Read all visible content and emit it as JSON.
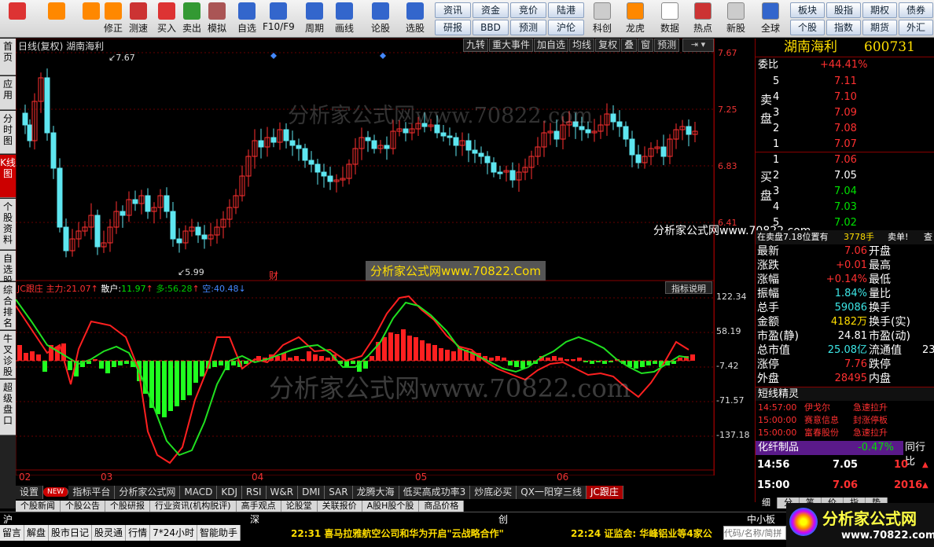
{
  "toolbar": {
    "left_buttons": [
      {
        "label": "",
        "icon": "grid-icon"
      },
      {
        "label": "",
        "icon": "back-arrow-icon"
      },
      {
        "label": "",
        "icon": "up-arrow-icon"
      },
      {
        "label": "修正",
        "icon": "refresh-icon"
      },
      {
        "label": "测速",
        "icon": "clock-icon"
      },
      {
        "label": "买入",
        "icon": "buy-icon"
      },
      {
        "label": "卖出",
        "icon": "sell-icon"
      },
      {
        "label": "模拟",
        "icon": "hammer-icon"
      },
      {
        "label": "自选",
        "icon": "star-icon"
      },
      {
        "label": "F10/F9",
        "icon": "f10-icon"
      },
      {
        "label": "周期",
        "icon": "cycle-icon"
      },
      {
        "label": "画线",
        "icon": "pencil-icon"
      },
      {
        "label": "论股",
        "icon": "discuss-icon"
      },
      {
        "label": "选股",
        "icon": "select-icon"
      }
    ],
    "grid1": [
      "资讯",
      "资金",
      "竞价",
      "陆港",
      "研报",
      "BBD",
      "预测",
      "沪伦"
    ],
    "mid_buttons": [
      {
        "label": "科创",
        "icon": "star-market-icon"
      },
      {
        "label": "龙虎",
        "icon": "dragon-icon"
      },
      {
        "label": "数据",
        "icon": "pe-icon"
      },
      {
        "label": "热点",
        "icon": "hot-icon"
      },
      {
        "label": "新股",
        "icon": "ipo-icon"
      },
      {
        "label": "全球",
        "icon": "globe-icon"
      }
    ],
    "grid2": [
      "板块",
      "股指",
      "期权",
      "债券",
      "个股",
      "指数",
      "期货",
      "外汇"
    ]
  },
  "left_tabs": [
    "首页",
    "应用",
    "分时图",
    "K线图",
    "个股资料",
    "自选股",
    "综合排名",
    "牛叉诊股",
    "超级盘口"
  ],
  "chart": {
    "header_left": "日线(复权) 湖南海利",
    "top_buttons": [
      "九转",
      "重大事件",
      "加自选",
      "均线",
      "复权",
      "叠",
      "窗",
      "预测"
    ],
    "price_high_label": "7.67",
    "price_low_label": "5.99",
    "event_marker": "财",
    "axis_prices": [
      "7.67",
      "7.25",
      "6.83",
      "6.41"
    ],
    "indicator_header": {
      "name": "JC跟庄",
      "main_label": "主力:",
      "main_value": "21.07",
      "retail_label": "散户:",
      "retail_value": "11.97",
      "long_label": "多:",
      "long_value": "56.28",
      "short_label": "空:",
      "short_value": "40.48"
    },
    "indicator_button": "指标说明",
    "indicator_axis": [
      "122.34",
      "58.19",
      "-7.42",
      "-71.57",
      "-137.18"
    ],
    "watermarks": [
      "分析家公式网www.70822.com",
      "分析家公式网www.70822.Com",
      "分析家公式网www.70822.com"
    ],
    "month_labels": [
      "02",
      "03",
      "04",
      "05",
      "06"
    ]
  },
  "indicator_tabs": [
    "设置",
    "NEW",
    "指标平台",
    "分析家公式网",
    "MACD",
    "KDJ",
    "RSI",
    "W&R",
    "DMI",
    "SAR",
    "龙腾大海",
    "低买高成功率3",
    "炒底必买",
    "QX一阳穿三线",
    "JC跟庄"
  ],
  "info_tabs": [
    "个股新闻",
    "个股公告",
    "个股研报",
    "行业资讯(机构脱评)",
    "高手观点",
    "论股堂",
    "关联报价",
    "A股H股个股",
    "商品价格"
  ],
  "quote": {
    "name": "湖南海利",
    "code": "600731",
    "weibi_label": "委比",
    "weibi_value": "+44.41%",
    "sell_label": "卖盘",
    "buy_label": "买盘",
    "sell": [
      {
        "lv": "5",
        "p": "7.11"
      },
      {
        "lv": "4",
        "p": "7.10"
      },
      {
        "lv": "3",
        "p": "7.09"
      },
      {
        "lv": "2",
        "p": "7.08"
      },
      {
        "lv": "1",
        "p": "7.07"
      }
    ],
    "buy": [
      {
        "lv": "1",
        "p": "7.06"
      },
      {
        "lv": "2",
        "p": "7.05"
      },
      {
        "lv": "3",
        "p": "7.04"
      },
      {
        "lv": "4",
        "p": "7.03"
      },
      {
        "lv": "5",
        "p": "7.02"
      }
    ],
    "watermark": "分析家公式网www.70822.com",
    "order_line": {
      "text": "在卖盘7.18位置有",
      "qty": "3778手",
      "side": "卖单!",
      "more": "查"
    },
    "stats": [
      {
        "l1": "最新",
        "v1": "7.06",
        "l2": "开盘",
        "c1": "red"
      },
      {
        "l1": "涨跌",
        "v1": "+0.01",
        "l2": "最高",
        "c1": "red"
      },
      {
        "l1": "涨幅",
        "v1": "+0.14%",
        "l2": "最低",
        "c1": "red"
      },
      {
        "l1": "振幅",
        "v1": "1.84%",
        "l2": "量比",
        "c1": "cyan"
      },
      {
        "l1": "总手",
        "v1": "59086",
        "l2": "换手",
        "c1": "cyan"
      },
      {
        "l1": "金额",
        "v1": "4182万",
        "l2": "换手(实)",
        "c1": "yellow"
      },
      {
        "l1": "市盈(静)",
        "v1": "24.81",
        "l2": "市盈(动)",
        "c1": "white"
      },
      {
        "l1": "总市值",
        "v1": "25.08亿",
        "l2": "流通值",
        "c1": "cyan",
        "v2": "23"
      },
      {
        "l1": "涨停",
        "v1": "7.76",
        "l2": "跌停",
        "c1": "red"
      },
      {
        "l1": "外盘",
        "v1": "28495",
        "l2": "内盘",
        "c1": "red"
      }
    ],
    "elves_title": "短线精灵",
    "elves": [
      {
        "t": "14:57:00",
        "n": "伊戈尔",
        "e": "急速拉升"
      },
      {
        "t": "15:00:00",
        "n": "赛意信息",
        "e": "封涨停板"
      },
      {
        "t": "15:00:00",
        "n": "富春股份",
        "e": "急速拉升"
      }
    ],
    "sector": {
      "name": "化纤制品",
      "chg": "-0.47%",
      "btn": "同行比"
    },
    "ticks": [
      {
        "t": "14:56",
        "p": "7.05",
        "v": "10",
        "dir": "▲"
      },
      {
        "t": "15:00",
        "p": "7.06",
        "v": "2016",
        "dir": "▲"
      }
    ],
    "bottom_tabs": [
      "细",
      "分",
      "笔",
      "价",
      "指",
      "势"
    ]
  },
  "index_bar": [
    "沪",
    "深",
    "创",
    "中小板"
  ],
  "status": {
    "items": [
      "留言",
      "解盘",
      "股市日记",
      "股灵通",
      "行情",
      "7*24小时",
      "智能助手"
    ],
    "news1": "22:31 喜马拉雅航空公司和华为开启\"云战略合作\"",
    "news2": "22:24 证监会: 华峰铝业等4家公",
    "search_placeholder": "代码/名称/简拼",
    "logo_text": "分析家公式网",
    "logo_url": "www.70822.com"
  }
}
